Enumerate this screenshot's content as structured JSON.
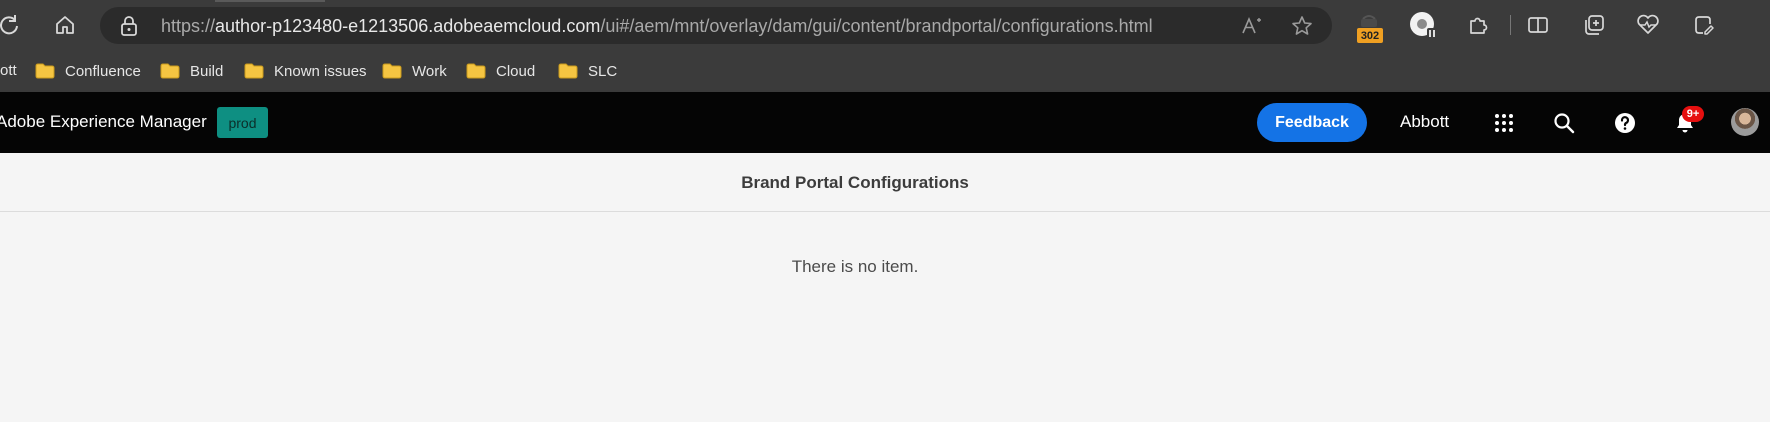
{
  "browser": {
    "url": {
      "scheme": "https://",
      "host": "author-p123480-e1213506.adobeaemcloud.com",
      "path": "/ui#/aem/mnt/overlay/dam/gui/content/brandportal/configurations.html"
    },
    "extension_badge": "302",
    "icons": [
      "refresh-icon",
      "home-icon",
      "lock-icon",
      "read-aloud-icon",
      "favorite-star-icon",
      "extension-icon",
      "puzzle-icon",
      "split-screen-icon",
      "collections-icon",
      "health-icon",
      "copilot-icon"
    ]
  },
  "bookmarks": {
    "cut_label": "ott",
    "items": [
      {
        "label": "Confluence"
      },
      {
        "label": "Build"
      },
      {
        "label": "Known issues"
      },
      {
        "label": "Work"
      },
      {
        "label": "Cloud"
      },
      {
        "label": "SLC"
      }
    ]
  },
  "aem_header": {
    "brand": "Adobe Experience Manager",
    "environment": "prod",
    "feedback_label": "Feedback",
    "organization": "Abbott",
    "notification_count": "9+"
  },
  "page": {
    "title": "Brand Portal Configurations",
    "empty_message": "There is no item."
  },
  "colors": {
    "chrome_bg": "#3b3b3b",
    "header_bg": "#050505",
    "accent": "#1473e6",
    "env_badge": "#0e8f82",
    "notification": "#e60f0f",
    "content_bg": "#f5f5f5"
  }
}
